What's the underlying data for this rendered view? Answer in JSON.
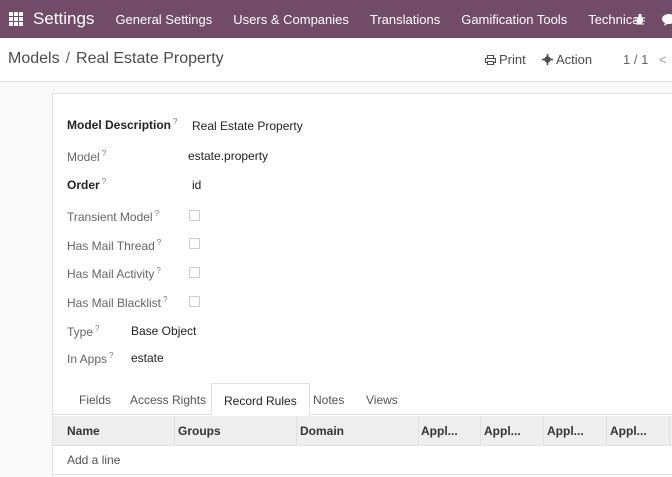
{
  "navbar": {
    "brand": "Settings",
    "menu": [
      "General Settings",
      "Users & Companies",
      "Translations",
      "Gamification Tools",
      "Technical"
    ],
    "icons": [
      "apps-grid-icon",
      "bug-icon",
      "chat-icon"
    ],
    "color": "#714B67"
  },
  "breadcrumb": {
    "root": "Models",
    "separator": "/",
    "current": "Real Estate Property"
  },
  "actions": {
    "print": "Print",
    "action": "Action"
  },
  "pager": {
    "value": "1 / 1",
    "prev": "<"
  },
  "form": {
    "model_description": {
      "label": "Model Description",
      "help": "?",
      "value": "Real Estate Property"
    },
    "model": {
      "label": "Model",
      "help": "?",
      "value": "estate.property"
    },
    "order": {
      "label": "Order",
      "help": "?",
      "value": "id"
    },
    "transient_model": {
      "label": "Transient Model",
      "help": "?",
      "checked": false
    },
    "has_mail_thread": {
      "label": "Has Mail Thread",
      "help": "?",
      "checked": false
    },
    "has_mail_activity": {
      "label": "Has Mail Activity",
      "help": "?",
      "checked": false
    },
    "has_mail_blacklist": {
      "label": "Has Mail Blacklist",
      "help": "?",
      "checked": false
    },
    "type": {
      "label": "Type",
      "help": "?",
      "value": "Base Object"
    },
    "in_apps": {
      "label": "In Apps",
      "help": "?",
      "value": "estate"
    }
  },
  "tabs": [
    {
      "label": "Fields",
      "active": false
    },
    {
      "label": "Access Rights",
      "active": false
    },
    {
      "label": "Record Rules",
      "active": true
    },
    {
      "label": "Notes",
      "active": false
    },
    {
      "label": "Views",
      "active": false
    }
  ],
  "table": {
    "columns": [
      "Name",
      "Groups",
      "Domain",
      "Appl...",
      "Appl...",
      "Appl...",
      "Appl..."
    ],
    "add_line": "Add a line"
  }
}
